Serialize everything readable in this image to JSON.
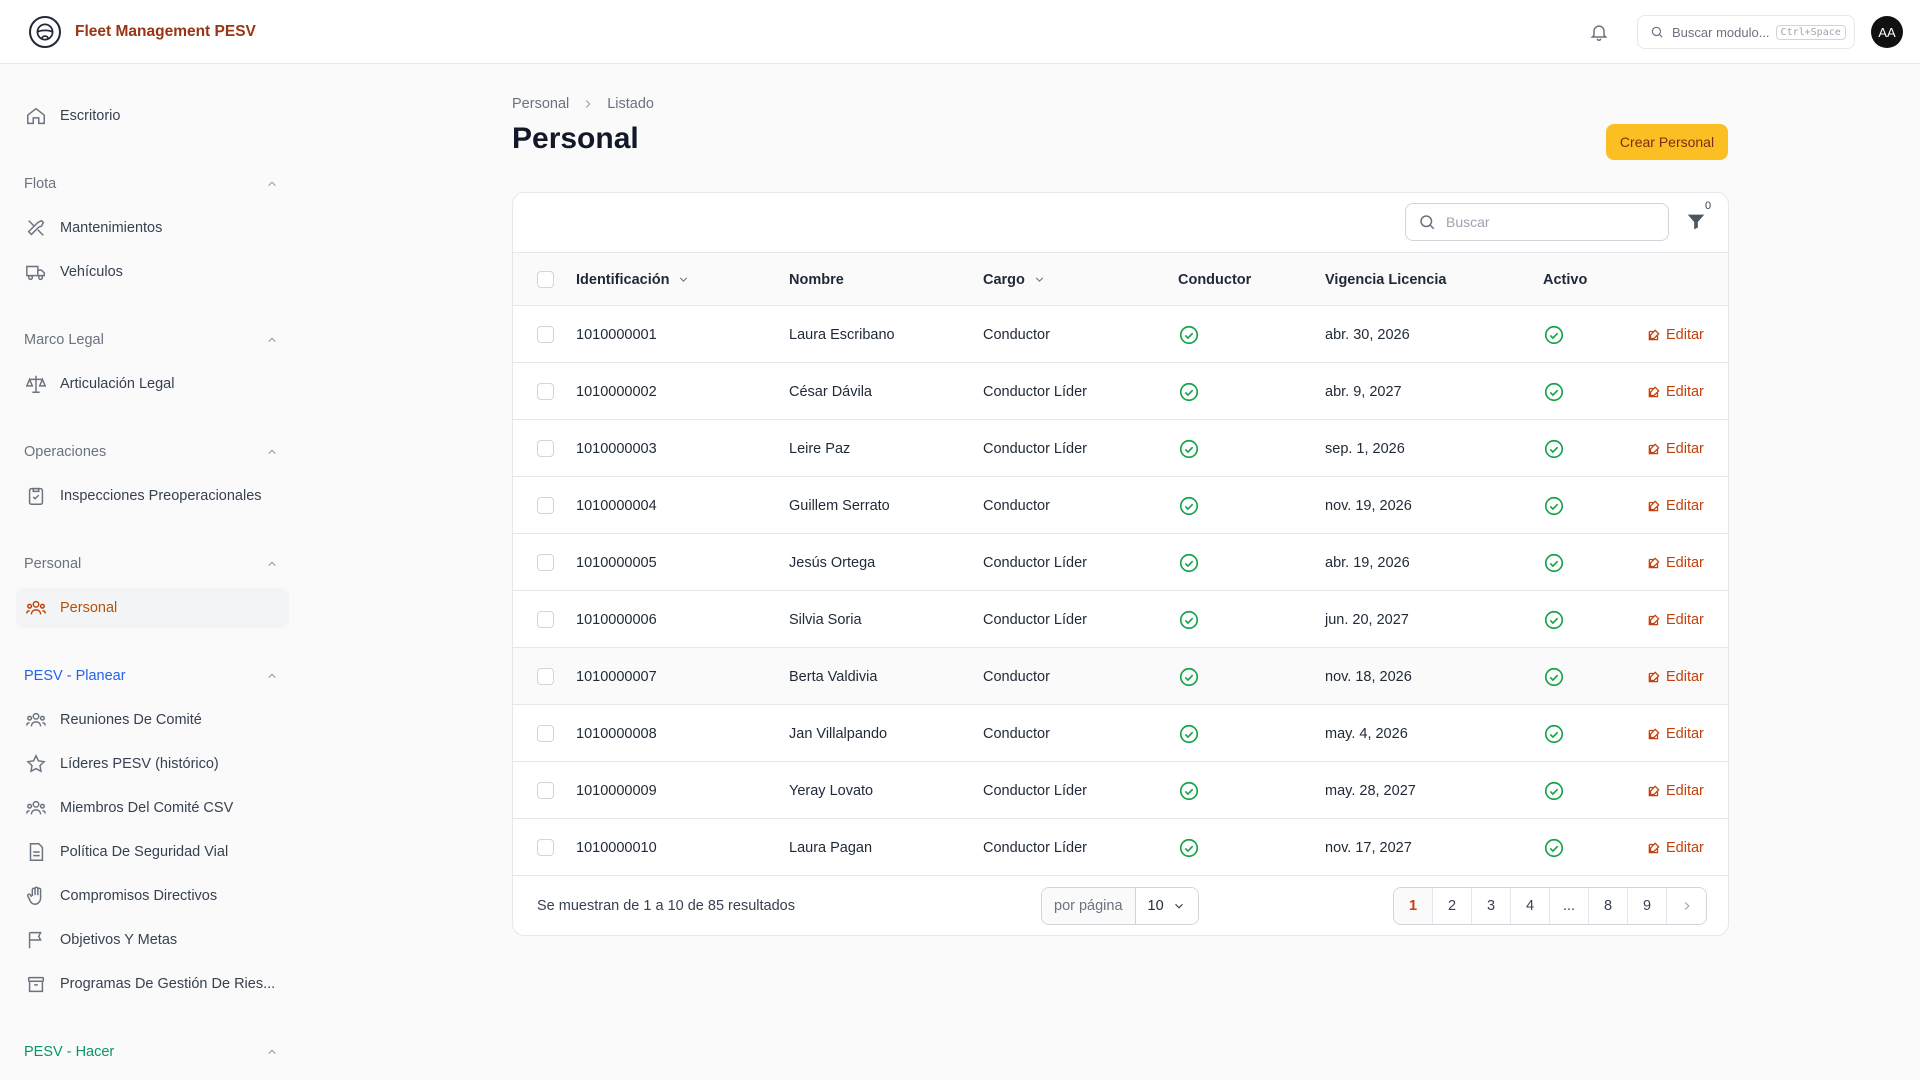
{
  "app": {
    "brand": "Fleet Management PESV",
    "search_placeholder": "Buscar modulo...",
    "search_shortcut": "Ctrl+Space",
    "avatar_initials": "AA"
  },
  "sidebar": {
    "top": {
      "label": "Escritorio",
      "icon": "home-icon"
    },
    "groups": [
      {
        "label": "Flota",
        "color": "#6b7280"
      },
      {
        "label": "Marco Legal",
        "color": "#6b7280"
      },
      {
        "label": "Operaciones",
        "color": "#6b7280"
      },
      {
        "label": "Personal",
        "color": "#6b7280"
      },
      {
        "label": "PESV - Planear",
        "color": "#2563eb"
      },
      {
        "label": "PESV - Hacer",
        "color": "#059669"
      }
    ],
    "items": [
      {
        "label": "Mantenimientos",
        "icon": "wrench-icon"
      },
      {
        "label": "Vehículos",
        "icon": "truck-icon"
      },
      {
        "label": "Articulación Legal",
        "icon": "scale-icon"
      },
      {
        "label": "Inspecciones Preoperacionales",
        "icon": "clipboard-check-icon"
      },
      {
        "label": "Personal",
        "icon": "users-icon",
        "active": true
      },
      {
        "label": "Reuniones De Comité",
        "icon": "users-icon"
      },
      {
        "label": "Líderes PESV (histórico)",
        "icon": "star-icon"
      },
      {
        "label": "Miembros Del Comité CSV",
        "icon": "users-icon"
      },
      {
        "label": "Política De Seguridad Vial",
        "icon": "document-icon"
      },
      {
        "label": "Compromisos Directivos",
        "icon": "hand-icon"
      },
      {
        "label": "Objetivos Y Metas",
        "icon": "flag-icon"
      },
      {
        "label": "Programas De Gestión De Ries...",
        "icon": "archive-icon"
      }
    ]
  },
  "breadcrumb": [
    "Personal",
    "Listado"
  ],
  "page": {
    "title": "Personal",
    "create_label": "Crear Personal"
  },
  "table": {
    "search_placeholder": "Buscar",
    "filter_count": "0",
    "columns": [
      "Identificación",
      "Nombre",
      "Cargo",
      "Conductor",
      "Vigencia Licencia",
      "Activo"
    ],
    "edit_label": "Editar",
    "rows": [
      {
        "id": "1010000001",
        "nombre": "Laura Escribano",
        "cargo": "Conductor",
        "vigencia": "abr. 30, 2026"
      },
      {
        "id": "1010000002",
        "nombre": "César Dávila",
        "cargo": "Conductor Líder",
        "vigencia": "abr. 9, 2027"
      },
      {
        "id": "1010000003",
        "nombre": "Leire Paz",
        "cargo": "Conductor Líder",
        "vigencia": "sep. 1, 2026"
      },
      {
        "id": "1010000004",
        "nombre": "Guillem Serrato",
        "cargo": "Conductor",
        "vigencia": "nov. 19, 2026"
      },
      {
        "id": "1010000005",
        "nombre": "Jesús Ortega",
        "cargo": "Conductor Líder",
        "vigencia": "abr. 19, 2026"
      },
      {
        "id": "1010000006",
        "nombre": "Silvia Soria",
        "cargo": "Conductor Líder",
        "vigencia": "jun. 20, 2027"
      },
      {
        "id": "1010000007",
        "nombre": "Berta Valdivia",
        "cargo": "Conductor",
        "vigencia": "nov. 18, 2026"
      },
      {
        "id": "1010000008",
        "nombre": "Jan Villalpando",
        "cargo": "Conductor",
        "vigencia": "may. 4, 2026"
      },
      {
        "id": "1010000009",
        "nombre": "Yeray Lovato",
        "cargo": "Conductor Líder",
        "vigencia": "may. 28, 2027"
      },
      {
        "id": "1010000010",
        "nombre": "Laura Pagan",
        "cargo": "Conductor Líder",
        "vigencia": "nov. 17, 2027"
      }
    ]
  },
  "pagination": {
    "results_text": "Se muestran de 1 a 10 de 85 resultados",
    "per_page_label": "por página",
    "per_page_value": "10",
    "pages": [
      "1",
      "2",
      "3",
      "4",
      "...",
      "8",
      "9"
    ],
    "current": "1"
  },
  "colors": {
    "accent": "#fbbf24",
    "brand": "#9a3412",
    "success": "#16a34a",
    "edit": "#c2410c"
  }
}
